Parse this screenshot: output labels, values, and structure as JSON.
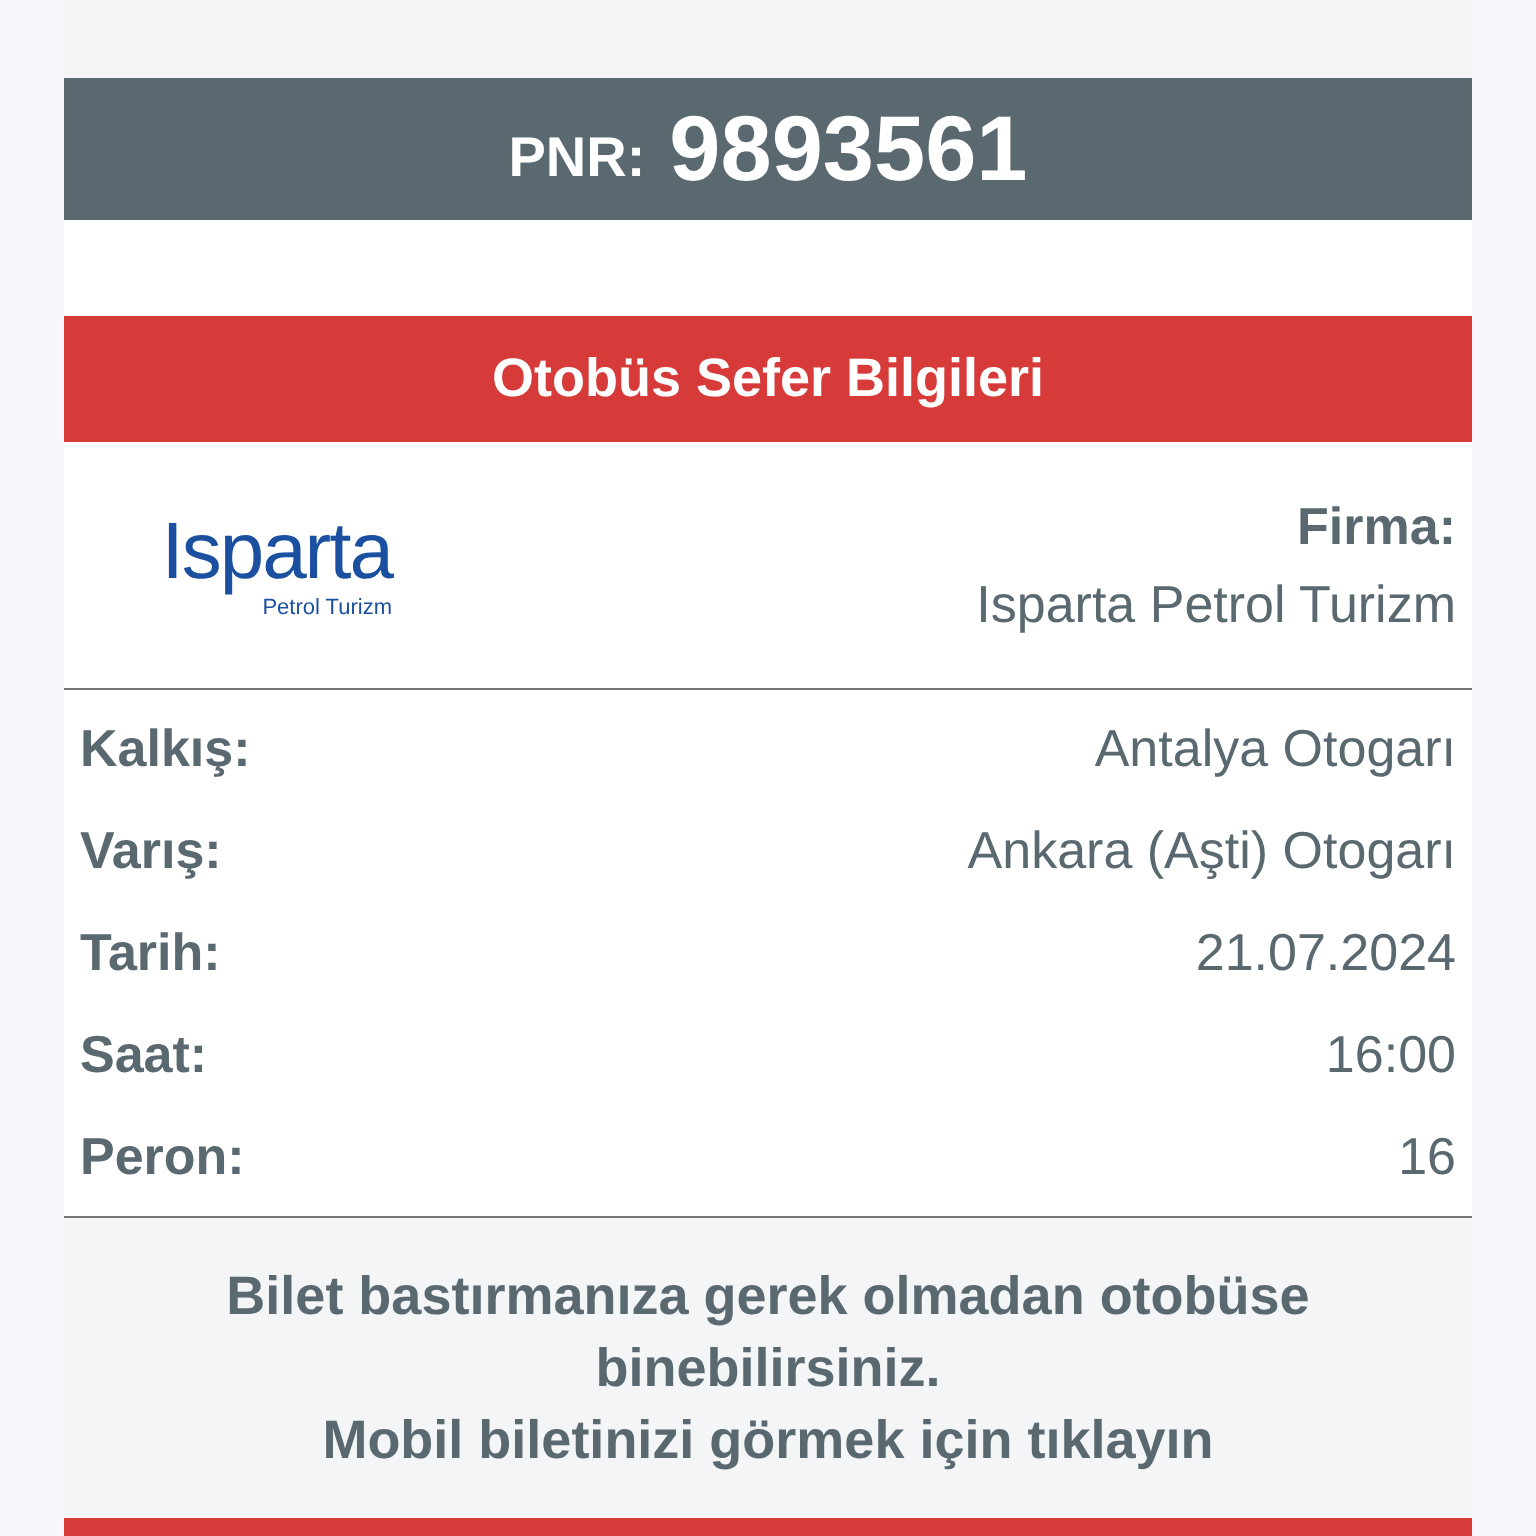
{
  "pnr": {
    "label": "PNR:",
    "value": "9893561"
  },
  "trip_header": "Otobüs Sefer Bilgileri",
  "company": {
    "logo_text": "Isparta",
    "logo_subtext": "Petrol Turizm",
    "label": "Firma:",
    "value": "Isparta Petrol Turizm"
  },
  "details": [
    {
      "label": "Kalkış:",
      "value": "Antalya Otogarı"
    },
    {
      "label": "Varış:",
      "value": "Ankara (Aşti) Otogarı"
    },
    {
      "label": "Tarih:",
      "value": "21.07.2024"
    },
    {
      "label": "Saat:",
      "value": "16:00"
    },
    {
      "label": "Peron:",
      "value": "16"
    }
  ],
  "notice": {
    "lines": [
      "Bilet bastırmanıza gerek olmadan otobüse binebilirsiniz.",
      "Mobil biletinizi görmek için tıklayın"
    ]
  }
}
